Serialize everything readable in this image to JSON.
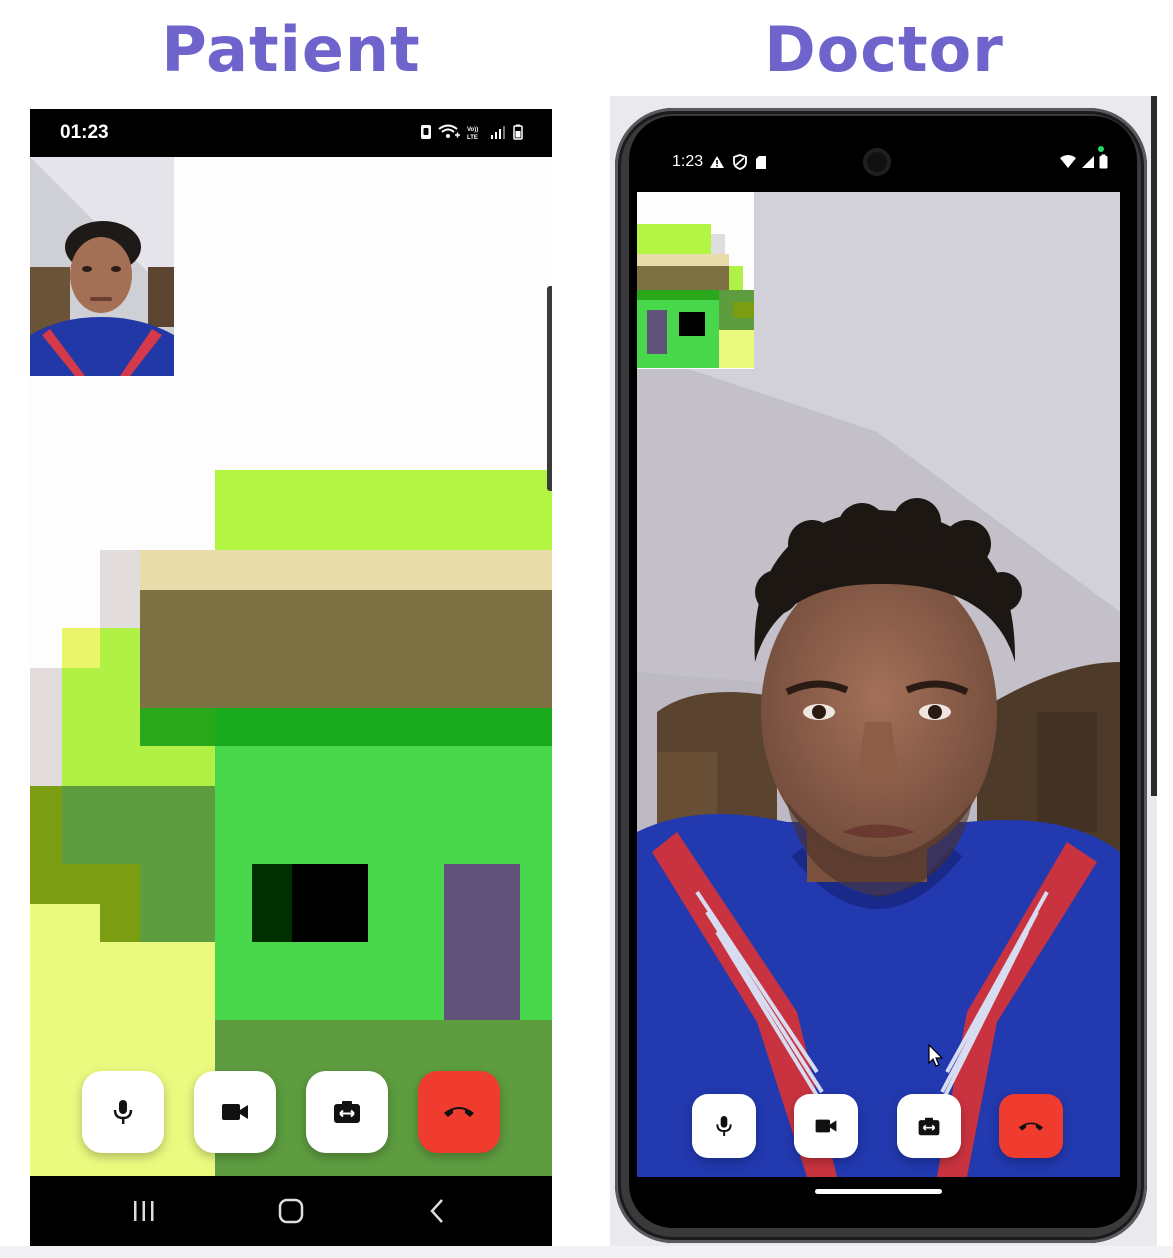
{
  "headings": {
    "patient": "Patient",
    "doctor": "Doctor"
  },
  "patient": {
    "status_bar": {
      "time": "01:23",
      "icons": [
        "nfc-icon",
        "wifi-plus-icon",
        "volte-lte-icon",
        "signal-icon",
        "battery-icon"
      ],
      "volte_text": "Vo)) LTE"
    },
    "remote_video": "pixelated-green-avatar",
    "local_video": "self-camera-preview",
    "controls": [
      "microphone-button",
      "camera-button",
      "switch-camera-button",
      "end-call-button"
    ],
    "navbar": [
      "recent-apps-button",
      "home-button",
      "back-button"
    ]
  },
  "doctor": {
    "status_bar": {
      "time": "1:23",
      "left_icons": [
        "warning-icon",
        "shield-icon",
        "sd-card-icon"
      ],
      "right_icons": [
        "wifi-icon",
        "signal-icon",
        "battery-icon"
      ]
    },
    "remote_video": "patient-camera-feed",
    "local_video": "pixelated-green-avatar",
    "controls": [
      "microphone-button",
      "camera-button",
      "switch-camera-button",
      "end-call-button"
    ]
  },
  "colors": {
    "heading": "#6f63cc",
    "end_call": "#f03b2f",
    "control_bg": "#ffffff"
  }
}
